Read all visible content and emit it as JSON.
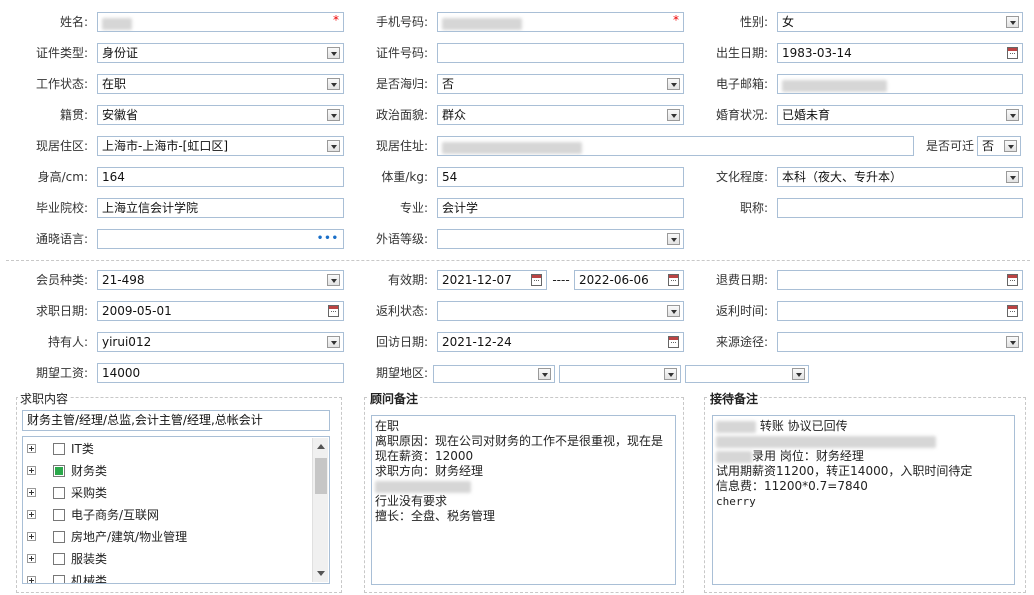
{
  "labels": {
    "name": "姓名:",
    "phone": "手机号码:",
    "gender": "性别:",
    "id_type": "证件类型:",
    "id_number": "证件号码:",
    "birth_date": "出生日期:",
    "work_status": "工作状态:",
    "returnee": "是否海归:",
    "email": "电子邮箱:",
    "native_place": "籍贯:",
    "political": "政治面貌:",
    "marital": "婚育状况:",
    "residence_area": "现居住区:",
    "residence_address": "现居住址:",
    "relocate": "是否可迁",
    "height": "身高/cm:",
    "weight": "体重/kg:",
    "education": "文化程度:",
    "school": "毕业院校:",
    "major": "专业:",
    "title": "职称:",
    "languages": "通晓语言:",
    "foreign_level": "外语等级:",
    "member_type": "会员种类:",
    "valid_period": "有效期:",
    "period_sep": "----",
    "refund_date": "退费日期:",
    "job_date": "求职日期:",
    "rebate_status": "返利状态:",
    "rebate_time": "返利时间:",
    "holder": "持有人:",
    "visit_date": "回访日期:",
    "source": "来源途径:",
    "salary": "期望工资:",
    "region": "期望地区:"
  },
  "values": {
    "gender": "女",
    "id_type": "身份证",
    "birth_date": "1983-03-14",
    "work_status": "在职",
    "returnee": "否",
    "native_place": "安徽省",
    "political": "群众",
    "marital": "已婚未育",
    "residence_area": "上海市-上海市-[虹口区]",
    "relocate": "否",
    "height": "164",
    "weight": "54",
    "education": "本科（夜大、专升本）",
    "school": "上海立信会计学院",
    "major": "会计学",
    "member_type": "21-498",
    "valid_from": "2021-12-07",
    "valid_to": "2022-06-06",
    "job_date": "2009-05-01",
    "holder": "yirui012",
    "visit_date": "2021-12-24",
    "salary": "14000",
    "required_mark": "*"
  },
  "job_content": {
    "title": "求职内容",
    "selected": "财务主管/经理/总监,会计主管/经理,总帐会计",
    "categories": [
      {
        "label": "IT类",
        "checked": false
      },
      {
        "label": "财务类",
        "checked": true
      },
      {
        "label": "采购类",
        "checked": false
      },
      {
        "label": "电子商务/互联网",
        "checked": false
      },
      {
        "label": "房地产/建筑/物业管理",
        "checked": false
      },
      {
        "label": "服装类",
        "checked": false
      },
      {
        "label": "机械类",
        "checked": false
      }
    ]
  },
  "advisor_notes": {
    "title": "顾问备注",
    "lines": [
      "在职",
      "离职原因：现在公司对财务的工作不是很重视，现在是",
      "现在薪资：12000",
      "求职方向：财务经理",
      "",
      "行业没有要求",
      "擅长：全盘、税务管理"
    ]
  },
  "reception_notes": {
    "title": "接待备注",
    "line1": "转账 协议已回传",
    "line3": "录用 岗位：财务经理",
    "line4": "试用期薪资11200，转正14000，入职时间待定",
    "line5": "信息费：11200*0.7=7840",
    "line6": "cherry"
  },
  "icons": {
    "dropdown": "chevron-down-icon",
    "calendar": "calendar-icon",
    "more": "ellipsis-icon",
    "expand": "plus-expand-icon"
  },
  "colors": {
    "border": "#a9bfd6",
    "required": "#e00000",
    "checked": "#2aa84a",
    "link_dots": "#1a6fc8"
  }
}
